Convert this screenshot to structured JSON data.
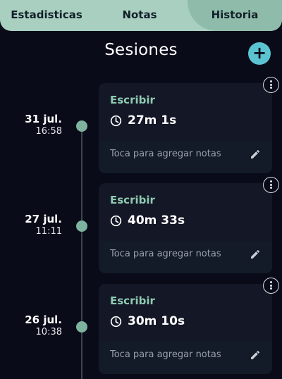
{
  "tabs": [
    {
      "label": "Estadisticas"
    },
    {
      "label": "Notas"
    },
    {
      "label": "Historia"
    }
  ],
  "header": {
    "title": "Sesiones",
    "add_label": "+"
  },
  "colors": {
    "accent": "#5cc4d0",
    "tab_background": "#a8cfc0",
    "label_green": "#8fcbb1",
    "timeline_dot": "#7db39f"
  },
  "sessions": [
    {
      "date": "31 jul.",
      "time": "16:58",
      "label": "Escribir",
      "duration": "27m 1s",
      "notes_placeholder": "Toca para agregar notas"
    },
    {
      "date": "27 jul.",
      "time": "11:11",
      "label": "Escribir",
      "duration": "40m 33s",
      "notes_placeholder": "Toca para agregar notas"
    },
    {
      "date": "26 jul.",
      "time": "10:38",
      "label": "Escribir",
      "duration": "30m 10s",
      "notes_placeholder": "Toca para agregar notas"
    }
  ],
  "icons": {
    "add": "plus-icon",
    "more": "more-vertical-icon",
    "clock": "clock-icon",
    "edit": "pencil-icon"
  }
}
